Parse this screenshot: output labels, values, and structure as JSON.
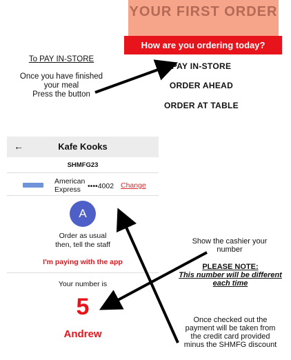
{
  "promo": {
    "banner_text": "YOUR FIRST ORDER",
    "question": "How are you ordering today?"
  },
  "options": [
    "PAY IN-STORE",
    "ORDER AHEAD",
    "ORDER AT TABLE"
  ],
  "left_note": {
    "title": "To PAY IN-STORE",
    "lines": [
      "Once you have finished",
      "your meal",
      "Press the button"
    ]
  },
  "phone": {
    "back_icon": "arrow-left-icon",
    "title": "Kafe Kooks",
    "code": "SHMFG23",
    "card": {
      "name_line1": "American",
      "name_line2": "Express",
      "masked": "••••4002",
      "change_label": "Change"
    },
    "avatar_letter": "A",
    "order_usual_line1": "Order as usual",
    "order_usual_line2": "then, tell the staff",
    "paying_label": "I'm paying with the app",
    "your_number_label": "Your number is",
    "number": "5",
    "customer_name": "Andrew"
  },
  "right_notes": {
    "show_line1": "Show the cashier your",
    "show_line2": "number",
    "please_note": "PLEASE NOTE:",
    "diff_line1": "This number will be different",
    "diff_line2": "each time",
    "checked_line1": "Once checked out the",
    "checked_line2": "payment will be taken from",
    "checked_line3": "the credit card provided",
    "checked_line4": "minus the SHMFG discount"
  },
  "colors": {
    "red": "#e8141c",
    "promo": "#f6a58a",
    "avatar": "#4e60c7",
    "header_bg": "#ececec"
  }
}
